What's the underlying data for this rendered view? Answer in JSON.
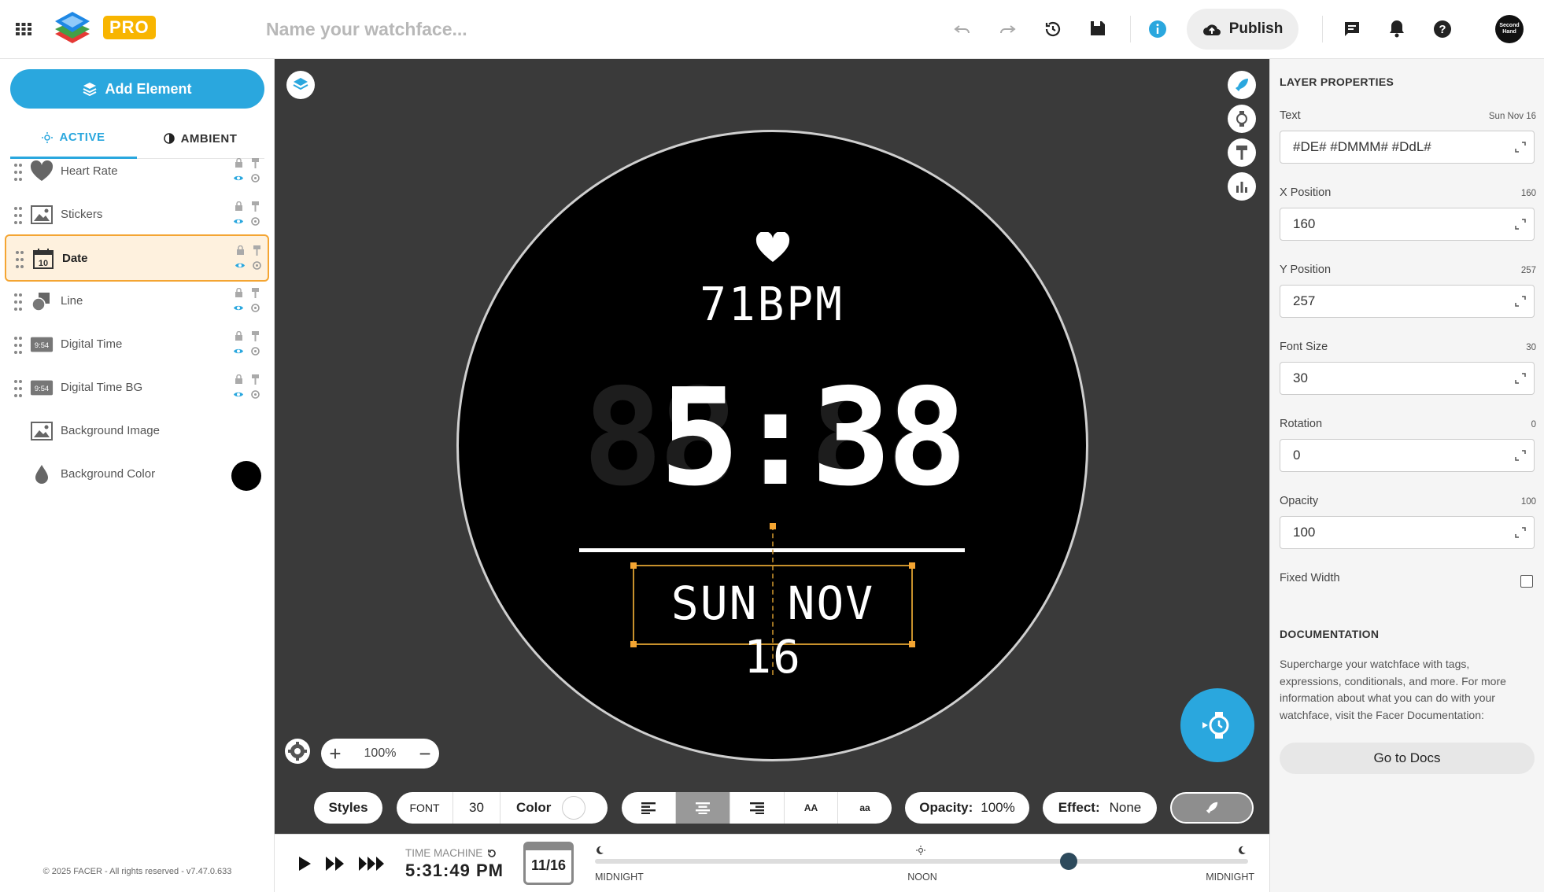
{
  "topbar": {
    "pro_label": "PRO",
    "name_placeholder": "Name your watchface...",
    "publish_label": "Publish",
    "avatar_text": "Second Hand"
  },
  "left": {
    "add_element_label": "Add Element",
    "tabs": [
      {
        "label": "ACTIVE",
        "active": true
      },
      {
        "label": "AMBIENT",
        "active": false
      }
    ],
    "layers": [
      {
        "name": "Heart Rate",
        "icon": "heart-icon"
      },
      {
        "name": "Stickers",
        "icon": "image-icon"
      },
      {
        "name": "Date",
        "icon": "calendar-icon",
        "icon_text": "10",
        "selected": true
      },
      {
        "name": "Line",
        "icon": "shapes-icon"
      },
      {
        "name": "Digital Time",
        "icon": "digital-time-icon",
        "icon_text": "9:54"
      },
      {
        "name": "Digital Time BG",
        "icon": "digital-time-icon",
        "icon_text": "9:54"
      },
      {
        "name": "Background Image",
        "icon": "image-icon"
      },
      {
        "name": "Background Color",
        "icon": "drop-icon",
        "swatch": "#000000"
      }
    ],
    "footer": "© 2025 FACER - All rights reserved - v7.47.0.633"
  },
  "canvas": {
    "zoom_level": "100%",
    "watch": {
      "heart_rate_text": "71BPM",
      "time_text": "5:38",
      "time_bg_text": "88:88",
      "date_text": "SUN NOV 16"
    }
  },
  "toolbar": {
    "styles_label": "Styles",
    "font_label": "FONT",
    "font_size": "30",
    "color_label": "Color",
    "case_upper": "AA",
    "case_lower": "aa",
    "opacity_label": "Opacity:",
    "opacity_value": "100%",
    "effect_label": "Effect:",
    "effect_value": "None"
  },
  "timebar": {
    "time_machine_label": "TIME MACHINE",
    "time_value": "5:31:49 PM",
    "date_value": "11/16",
    "slider_labels": [
      "MIDNIGHT",
      "NOON",
      "MIDNIGHT"
    ],
    "slider_position": 0.725
  },
  "properties": {
    "title": "LAYER PROPERTIES",
    "fields": [
      {
        "label": "Text",
        "value_hint": "Sun Nov 16",
        "input": "#DE# #DMMM# #DdL#"
      },
      {
        "label": "X Position",
        "value_hint": "160",
        "input": "160"
      },
      {
        "label": "Y Position",
        "value_hint": "257",
        "input": "257"
      },
      {
        "label": "Font Size",
        "value_hint": "30",
        "input": "30"
      },
      {
        "label": "Rotation",
        "value_hint": "0",
        "input": "0"
      },
      {
        "label": "Opacity",
        "value_hint": "100",
        "input": "100"
      }
    ],
    "fixed_width_label": "Fixed Width",
    "doc_title": "DOCUMENTATION",
    "doc_text": "Supercharge your watchface with tags, expressions, conditionals, and more. For more information about what you can do with your watchface, visit the Facer Documentation:",
    "docs_button": "Go to Docs"
  },
  "colors": {
    "accent": "#2aa7de",
    "selection": "#f4a532",
    "canvas": "#3a3a3a"
  }
}
